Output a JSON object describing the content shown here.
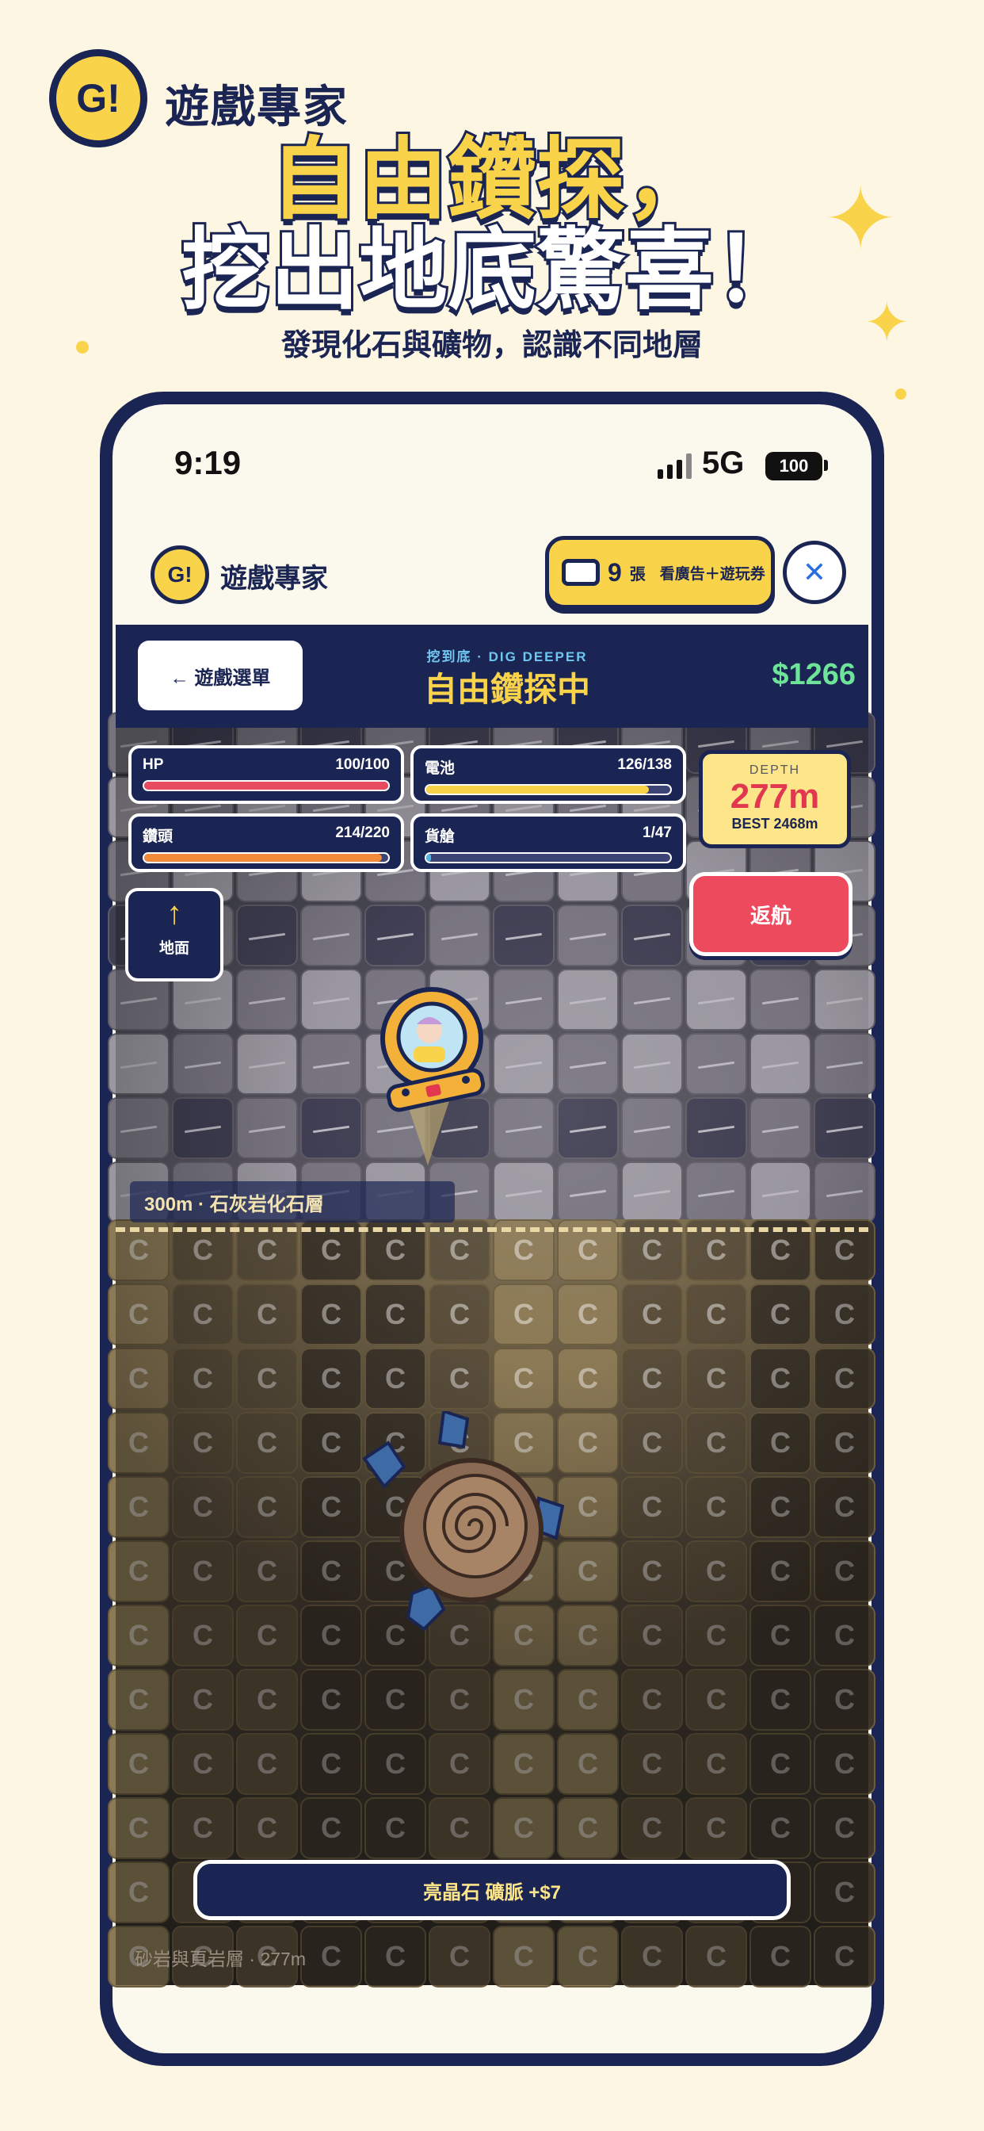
{
  "banner": {
    "brand_badge": "G!",
    "brand_name": "遊戲專家",
    "headline_line1": "自由鑽探，",
    "headline_line2": "挖出地底驚喜！",
    "subline": "發現化石與礦物，認識不同地層"
  },
  "status_bar": {
    "time": "9:19",
    "network": "5G",
    "battery": "100"
  },
  "app_header": {
    "logo": "G!",
    "title": "遊戲專家",
    "ticket_count": "9",
    "ticket_unit": "張",
    "ticket_label": "看廣告＋遊玩券",
    "close_icon": "close-icon"
  },
  "game_header": {
    "back_label": "← 遊戲選單",
    "subtitle": "挖到底 · DIG DEEPER",
    "title": "自由鑽探中",
    "money": "$1266"
  },
  "hud": {
    "hp": {
      "label": "HP",
      "value": "100/100",
      "fraction": 1.0,
      "color": "#e84a60"
    },
    "battery": {
      "label": "電池",
      "value": "126/138",
      "fraction": 0.913,
      "color": "#f9d34a"
    },
    "drill": {
      "label": "鑽頭",
      "value": "214/220",
      "fraction": 0.973,
      "color": "#f28a3a"
    },
    "cargo": {
      "label": "貨艙",
      "value": "1/47",
      "fraction": 0.021,
      "color": "#52b7e8"
    },
    "depth": {
      "label": "DEPTH",
      "value": "277m",
      "best": "BEST 2468m"
    },
    "return_label": "返航",
    "surface_label": "地面",
    "surface_icon": "arrow-up-icon"
  },
  "layer": {
    "marker": "300m · 石灰岩化石層",
    "current": "砂岩與頁岩層 · 277m"
  },
  "mineral_notice": "亮晶石 礦脈 +$7",
  "colors": {
    "navy": "#1b2553",
    "yellow": "#f9d34a",
    "red": "#ed4a5e",
    "green": "#6ee39a",
    "cream": "#fdf6e3"
  }
}
